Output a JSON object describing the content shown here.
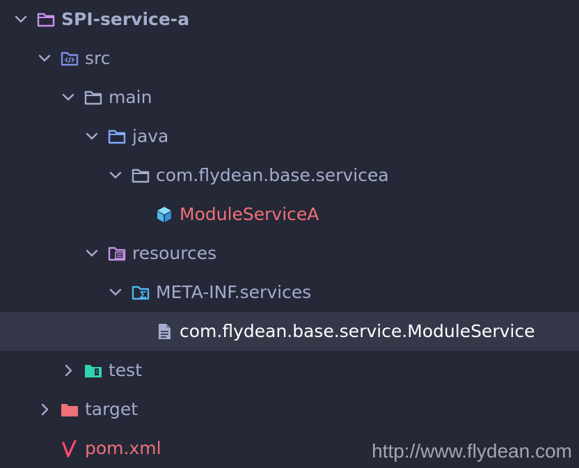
{
  "tree": {
    "root": {
      "label": "SPI-service-a",
      "icon": "folder-icon",
      "expanded": true
    },
    "src": {
      "label": "src",
      "icon": "source-folder-icon",
      "expanded": true
    },
    "main": {
      "label": "main",
      "icon": "folder-icon",
      "expanded": true
    },
    "java": {
      "label": "java",
      "icon": "folder-icon",
      "expanded": true
    },
    "package": {
      "label": "com.flydean.base.servicea",
      "icon": "package-folder-icon",
      "expanded": true
    },
    "module_class": {
      "label": "ModuleServiceA",
      "icon": "module-cube-icon",
      "color": "#f07178"
    },
    "resources": {
      "label": "resources",
      "icon": "resources-folder-icon",
      "expanded": true
    },
    "meta_inf": {
      "label": "META-INF.services",
      "icon": "services-folder-icon",
      "expanded": true
    },
    "service_file": {
      "label": "com.flydean.base.service.ModuleService",
      "icon": "text-file-icon",
      "selected": true
    },
    "test": {
      "label": "test",
      "icon": "test-folder-icon",
      "expanded": false
    },
    "target": {
      "label": "target",
      "icon": "target-folder-icon",
      "expanded": false
    },
    "pom": {
      "label": "pom.xml",
      "icon": "maven-icon",
      "color": "#f07178"
    }
  },
  "watermark": "http://www.flydean.com",
  "colors": {
    "background": "#252837",
    "selection": "#343849",
    "text": "#a6accd",
    "highlight": "#f07178"
  }
}
